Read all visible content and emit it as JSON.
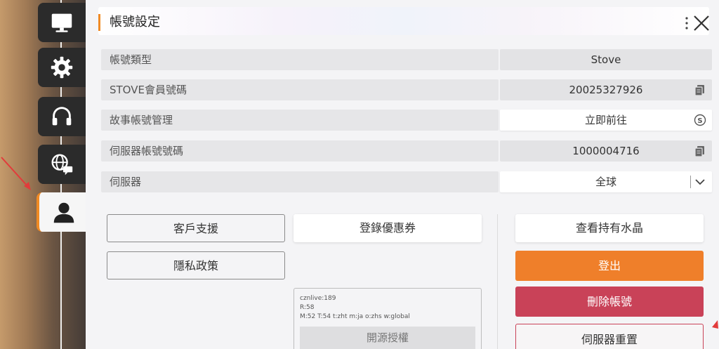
{
  "header": {
    "title": "帳號設定"
  },
  "sidebar": {
    "tabs": [
      {
        "icon": "monitor-icon",
        "active": false
      },
      {
        "icon": "gear-icon",
        "active": false
      },
      {
        "icon": "headset-icon",
        "active": false
      },
      {
        "icon": "globe-chat-icon",
        "active": false
      },
      {
        "icon": "user-icon",
        "active": true
      }
    ]
  },
  "rows": [
    {
      "label": "帳號類型",
      "value": "Stove",
      "icon": null
    },
    {
      "label": "STOVE會員號碼",
      "value": "20025327926",
      "icon": "copy-icon"
    },
    {
      "label": "故事帳號管理",
      "value": "立即前往",
      "icon": "stove-s-icon"
    },
    {
      "label": "伺服器帳號號碼",
      "value": "1000004716",
      "icon": "copy-icon"
    },
    {
      "label": "伺服器",
      "value": "全球",
      "icon": "chevron-down-icon"
    }
  ],
  "buttons": {
    "support": "客戶支援",
    "coupon": "登錄優惠券",
    "crystals": "查看持有水晶",
    "privacy": "隱私政策",
    "logout": "登出",
    "delete": "刪除帳號",
    "reset": "伺服器重置"
  },
  "info": {
    "line1": "cznlive:189",
    "line2": "R:58",
    "line3": "M:52 T:54 t:zht m:ja o:zhs w:global",
    "license": "開源授權"
  },
  "colors": {
    "accent": "#f08a24",
    "logout": "#ef7f2a",
    "delete": "#c94258"
  }
}
